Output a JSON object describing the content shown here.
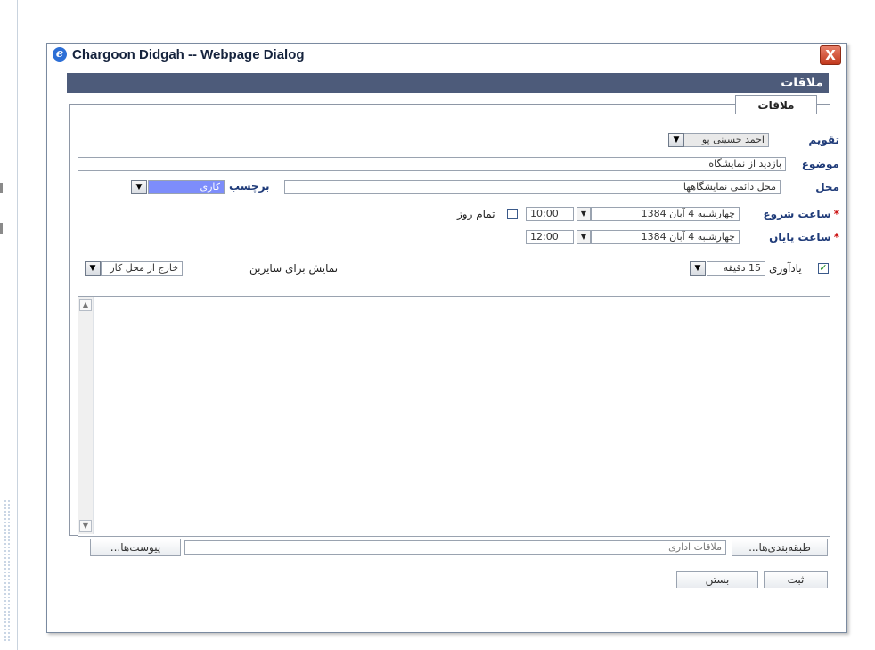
{
  "window": {
    "title": "Chargoon Didgah -- Webpage Dialog",
    "close_glyph": "X"
  },
  "header": {
    "title": "ملاقات"
  },
  "tab": {
    "label": "ملاقات"
  },
  "form": {
    "calendar": {
      "label": "تقویم",
      "value": "احمد حسینی پو"
    },
    "subject": {
      "label": "موضوع",
      "value": "بازدید از نمایشگاه"
    },
    "location": {
      "label": "محل",
      "value": "محل دائمی نمایشگاهها"
    },
    "tag": {
      "label": "برچسب",
      "value": "کاری",
      "color": "#7d8dfb"
    },
    "start": {
      "label": "ساعت شروع",
      "date": "چهارشنبه 4 آبان 1384",
      "time": "10:00"
    },
    "end": {
      "label": "ساعت پایان",
      "date": "چهارشنبه 4 آبان 1384",
      "time": "12:00"
    },
    "all_day": {
      "label": "تمام روز",
      "checked": false
    },
    "required_mark": "*",
    "reminder": {
      "label": "یادآوری",
      "checked": true,
      "value": "15 دقیقه"
    },
    "show_others": {
      "label": "نمایش برای سایرین",
      "value": "خارج از محل کار"
    }
  },
  "categories": {
    "button": "طبقه‌بندی‌ها...",
    "value": "ملاقات اداری"
  },
  "attachments": {
    "button": "پیوست‌ها..."
  },
  "actions": {
    "submit": "ثبت",
    "close": "بستن"
  },
  "icons": {
    "browser": "ie-icon",
    "close": "close-icon",
    "dropdown": "chevron-down-icon",
    "checkmark": "check-icon"
  }
}
